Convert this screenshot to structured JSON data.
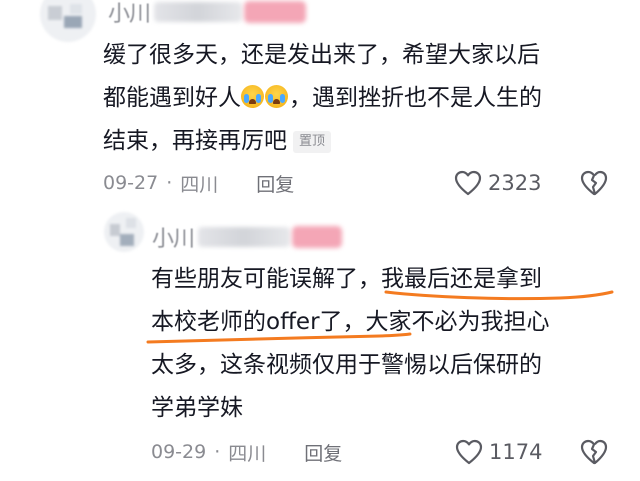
{
  "colors": {
    "text": "#161823",
    "meta": "#8a8b91",
    "underline": "#f47b20",
    "redaction_pink": "#f4a6b6"
  },
  "comments": [
    {
      "username_visible": "小川",
      "lines": [
        "缓了很多天，还是发出来了，希望大家以后",
        "都能遇到好人",
        "，遇到挫折也不是人生的",
        "结束，再接再厉吧"
      ],
      "emoji": "crying-face-icon",
      "pin_label": "置顶",
      "date": "09-27",
      "location": "四川",
      "separator": "·",
      "reply_label": "回复",
      "like_count": "2323"
    },
    {
      "username_visible": "小川",
      "lines": [
        "有些朋友可能误解了，我最后还是拿到",
        "本校老师的offer了，大家不必为我担心",
        "太多，这条视频仅用于警惕以后保研的",
        "学弟学妹"
      ],
      "date": "09-29",
      "location": "四川",
      "separator": "·",
      "reply_label": "回复",
      "like_count": "1174"
    }
  ]
}
